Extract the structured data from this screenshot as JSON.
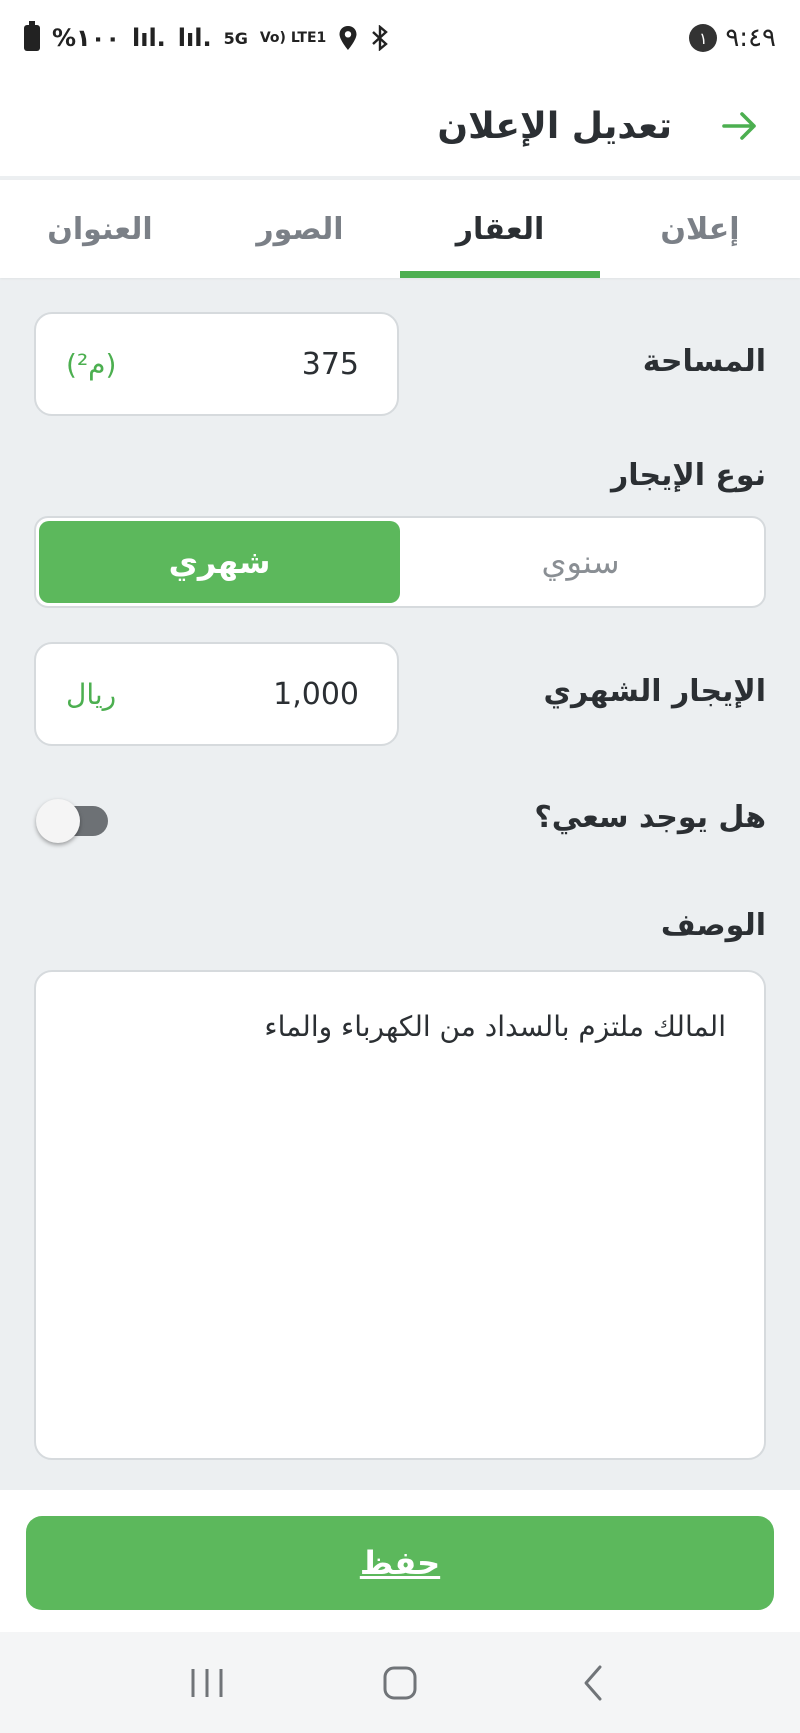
{
  "status_bar": {
    "battery": "%١٠٠",
    "signal1": "lıl.",
    "signal2": "lıl.",
    "network": "5G",
    "volte": "Vo) LTE1",
    "time": "٩:٤٩",
    "notification_count": "١"
  },
  "header": {
    "title": "تعديل الإعلان"
  },
  "tabs": [
    {
      "label": "إعلان"
    },
    {
      "label": "العقار"
    },
    {
      "label": "الصور"
    },
    {
      "label": "العنوان"
    }
  ],
  "form": {
    "area": {
      "label": "المساحة",
      "value": "375",
      "unit": "(م²)"
    },
    "rent_type": {
      "label": "نوع الإيجار",
      "options": [
        "شهري",
        "سنوي"
      ],
      "selected": "شهري"
    },
    "monthly_rent": {
      "label": "الإيجار الشهري",
      "value": "1,000",
      "unit": "ريال"
    },
    "broker": {
      "label": "هل يوجد سعي؟",
      "on": false
    },
    "description": {
      "label": "الوصف",
      "value": "المالك ملتزم بالسداد من الكهرباء والماء"
    }
  },
  "actions": {
    "save_label": "حفظ"
  },
  "colors": {
    "accent": "#5cb85c",
    "tab_indicator": "#4caf50"
  }
}
